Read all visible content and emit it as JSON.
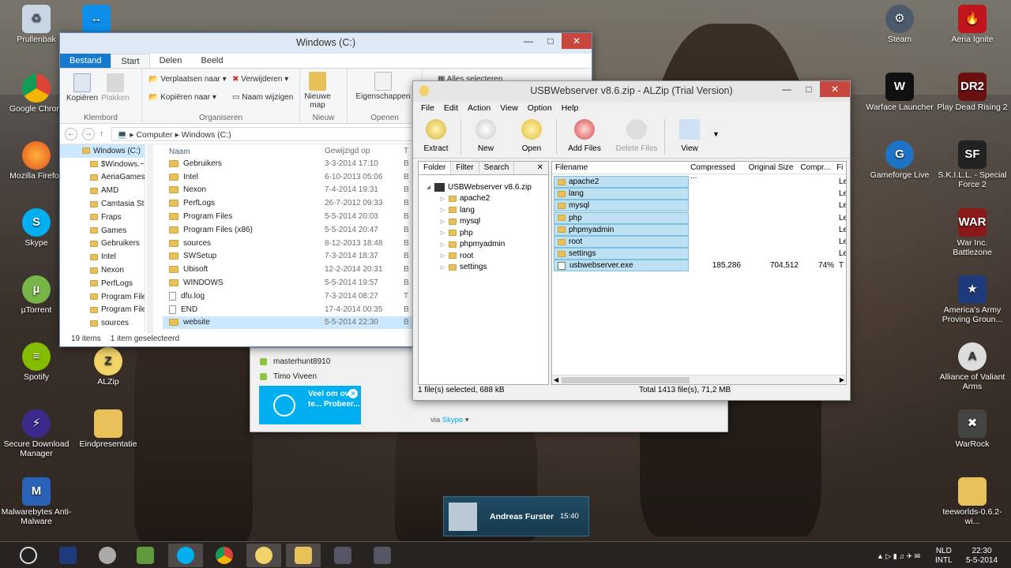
{
  "desktop_icons": {
    "prullenbak": "Prullenbak",
    "chrome": "Google Chrom",
    "firefox": "Mozilla Firefox",
    "skype": "Skype",
    "utorrent": "µTorrent",
    "spotify": "Spotify",
    "sdm": "Secure Download Manager",
    "malwarebytes": "Malwarebytes Anti-Malware",
    "alzip": "ALZip",
    "eindpresentatie": "Eindpresentatie",
    "steam": "Steam",
    "aeria": "Aeria Ignite",
    "warface": "Warface Launcher",
    "pdr2": "Play Dead Rising 2",
    "gameforge": "Gameforge Live",
    "skill": "S.K.I.L.L. - Special Force 2",
    "warinc": "War Inc. Battlezone",
    "americas": "America's Army Proving Groun...",
    "alliance": "Alliance of Valiant Arms",
    "warrock": "WarRock",
    "teeworlds": "teeworlds-0.6.2-wi..."
  },
  "explorer": {
    "title": "Windows (C:)",
    "tabs": {
      "file": "Bestand",
      "start": "Start",
      "share": "Delen",
      "view": "Beeld"
    },
    "ribbon": {
      "copy": "Kopiëren",
      "paste": "Plakken",
      "group_clipboard": "Klembord",
      "move_to": "Verplaatsen naar",
      "copy_to": "Kopiëren naar",
      "delete": "Verwijderen",
      "rename": "Naam wijzigen",
      "group_organize": "Organiseren",
      "new_folder": "Nieuwe map",
      "group_new": "Nieuw",
      "properties": "Eigenschappen",
      "group_open": "Openen",
      "select_all": "Alles selecteren"
    },
    "address": {
      "computer": "Computer",
      "drive": "Windows (C:)"
    },
    "nav": {
      "head": "Windows (C:)",
      "items": [
        "$Windows.~",
        "AeriaGames",
        "AMD",
        "Camtasia Stu",
        "Fraps",
        "Games",
        "Gebruikers",
        "Intel",
        "Nexon",
        "PerfLogs",
        "Program File",
        "Program File",
        "sources"
      ]
    },
    "columns": {
      "name": "Naam",
      "modified": "Gewijzigd op",
      "type": "T"
    },
    "files": [
      {
        "name": "Gebruikers",
        "date": "3-3-2014 17:10",
        "type": "B"
      },
      {
        "name": "Intel",
        "date": "6-10-2013 05:06",
        "type": "B"
      },
      {
        "name": "Nexon",
        "date": "7-4-2014 19:31",
        "type": "B"
      },
      {
        "name": "PerfLogs",
        "date": "26-7-2012 09:33",
        "type": "B"
      },
      {
        "name": "Program Files",
        "date": "5-5-2014 20:03",
        "type": "B"
      },
      {
        "name": "Program Files (x86)",
        "date": "5-5-2014 20:47",
        "type": "B"
      },
      {
        "name": "sources",
        "date": "8-12-2013 18:48",
        "type": "B"
      },
      {
        "name": "SWSetup",
        "date": "7-3-2014 18:37",
        "type": "B"
      },
      {
        "name": "Ubisoft",
        "date": "12-2-2014 20:31",
        "type": "B"
      },
      {
        "name": "WINDOWS",
        "date": "5-5-2014 19:57",
        "type": "B"
      },
      {
        "name": "dfu.log",
        "date": "7-3-2014 08:27",
        "type": "T"
      },
      {
        "name": "END",
        "date": "17-4-2014 00:35",
        "type": "B"
      },
      {
        "name": "website",
        "date": "5-5-2014 22:30",
        "type": "B"
      }
    ],
    "status": {
      "count": "19 items",
      "selected": "1 item geselecteerd"
    }
  },
  "skype": {
    "contact1": "masterhunt8910",
    "contact2": "Timo Viveen",
    "promo": "Veel om over te... Probeer...",
    "via": "via",
    "via_link": "Skype"
  },
  "alzip": {
    "title": "USBWebserver v8.6.zip - ALZip (Trial Version)",
    "menu": [
      "File",
      "Edit",
      "Action",
      "View",
      "Option",
      "Help"
    ],
    "toolbar": {
      "extract": "Extract",
      "new": "New",
      "open": "Open",
      "add_files": "Add Files",
      "delete_files": "Delete Files",
      "view": "View"
    },
    "panel_tabs": {
      "folder": "Folder",
      "filter": "Filter",
      "search": "Search"
    },
    "tree": {
      "root": "USBWebserver v8.6.zip",
      "items": [
        "apache2",
        "lang",
        "mysql",
        "php",
        "phpmyadmin",
        "root",
        "settings"
      ]
    },
    "columns": {
      "filename": "Filename",
      "compressed": "Compressed ...",
      "original": "Original Size",
      "ratio": "Compr...",
      "f": "Fi"
    },
    "files": [
      {
        "name": "apache2",
        "compressed": "",
        "original": "",
        "ratio": "",
        "f": "Le"
      },
      {
        "name": "lang",
        "compressed": "",
        "original": "",
        "ratio": "",
        "f": "Le"
      },
      {
        "name": "mysql",
        "compressed": "",
        "original": "",
        "ratio": "",
        "f": "Le"
      },
      {
        "name": "php",
        "compressed": "",
        "original": "",
        "ratio": "",
        "f": "Le"
      },
      {
        "name": "phpmyadmin",
        "compressed": "",
        "original": "",
        "ratio": "",
        "f": "Le"
      },
      {
        "name": "root",
        "compressed": "",
        "original": "",
        "ratio": "",
        "f": "Le"
      },
      {
        "name": "settings",
        "compressed": "",
        "original": "",
        "ratio": "",
        "f": "Le"
      },
      {
        "name": "usbwebserver.exe",
        "compressed": "185,286",
        "original": "704,512",
        "ratio": "74%",
        "f": "T"
      }
    ],
    "status": {
      "selected": "1 file(s) selected, 688 kB",
      "total": "Total 1413 file(s), 71,2 MB"
    }
  },
  "notification": {
    "name": "Andreas Furster",
    "time": "15:40"
  },
  "taskbar": {
    "lang1": "NLD",
    "lang2": "INTL",
    "time": "22:30",
    "date": "5-5-2014"
  }
}
